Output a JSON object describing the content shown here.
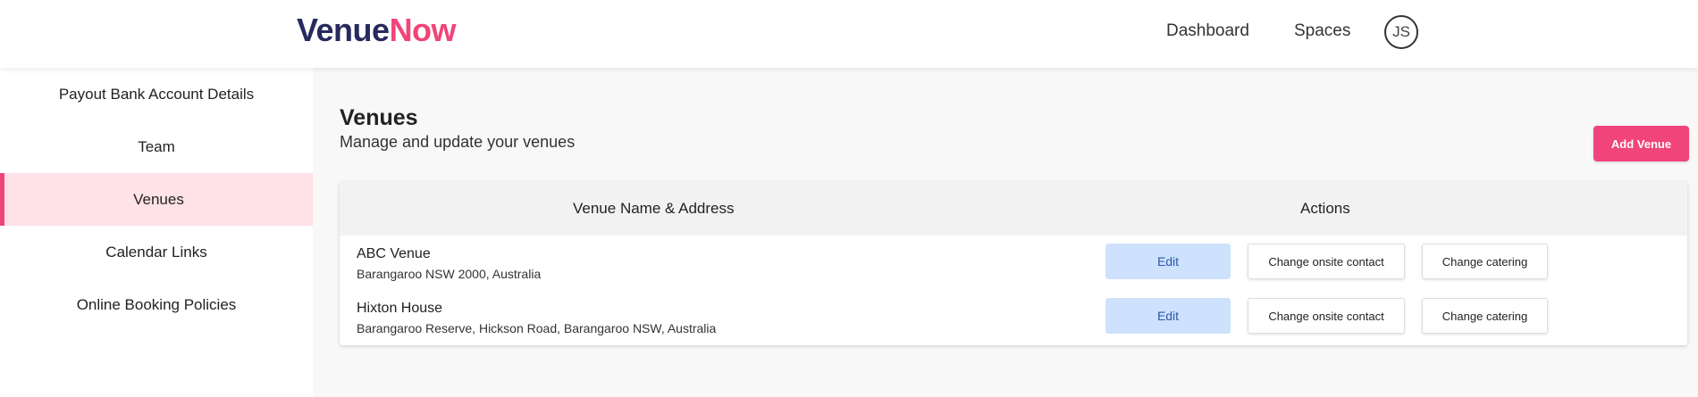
{
  "brand": {
    "part1": "Venue",
    "part2": "Now",
    "color1": "#262a5e",
    "color2": "#f0447a"
  },
  "nav": {
    "dashboard": "Dashboard",
    "spaces": "Spaces",
    "avatar_initials": "JS"
  },
  "sidebar": {
    "items": [
      {
        "label": "Payout Bank Account Details",
        "active": false
      },
      {
        "label": "Team",
        "active": false
      },
      {
        "label": "Venues",
        "active": true
      },
      {
        "label": "Calendar Links",
        "active": false
      },
      {
        "label": "Online Booking Policies",
        "active": false
      }
    ]
  },
  "main": {
    "title": "Venues",
    "subtitle": "Manage and update your venues",
    "add_button": "Add Venue",
    "table": {
      "headers": [
        "Venue Name & Address",
        "Actions"
      ],
      "rows": [
        {
          "name": "ABC Venue",
          "address": "Barangaroo NSW 2000, Australia",
          "edit": "Edit",
          "contact": "Change onsite contact",
          "catering": "Change catering"
        },
        {
          "name": "Hixton House",
          "address": "Barangaroo Reserve, Hickson Road, Barangaroo NSW, Australia",
          "edit": "Edit",
          "contact": "Change onsite contact",
          "catering": "Change catering"
        }
      ]
    }
  },
  "colors": {
    "accent": "#f0447a",
    "edit_bg": "#cfe2fd",
    "active_bg": "#ffe1e8"
  }
}
